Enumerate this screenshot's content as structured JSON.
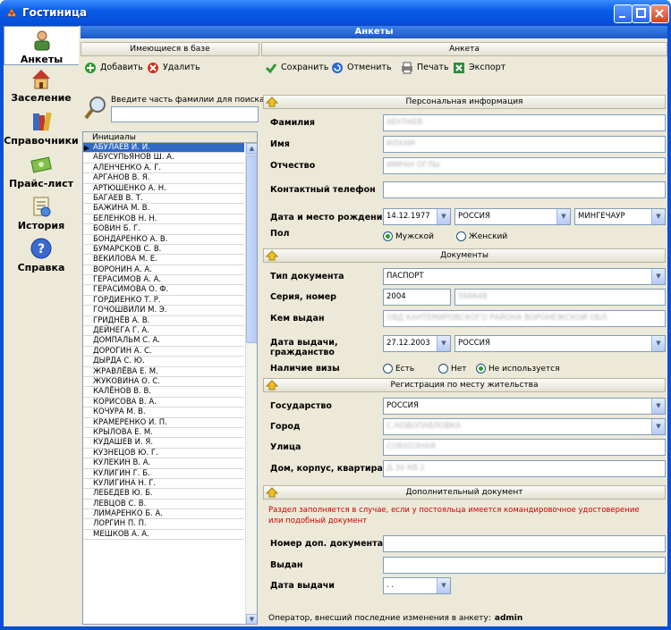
{
  "window": {
    "title": "Гостиница"
  },
  "nav": [
    {
      "label": "Анкеты",
      "icon": "person-icon"
    },
    {
      "label": "Заселение",
      "icon": "house-icon"
    },
    {
      "label": "Справочники",
      "icon": "books-icon"
    },
    {
      "label": "Прайс-лист",
      "icon": "money-icon"
    },
    {
      "label": "История",
      "icon": "clock-icon"
    },
    {
      "label": "Справка",
      "icon": "help-icon"
    }
  ],
  "top_strip": "Анкеты",
  "left": {
    "header": "Имеющиеся в базе",
    "add_label": "Добавить",
    "delete_label": "Удалить",
    "search_label": "Введите часть фамилии для поиска",
    "search_value": "",
    "column": "Инициалы",
    "rows": [
      "АБУЛАЕВ И. И.",
      "АБУСУПЬЯНОВ Ш. А.",
      "АЛЕНЧЕНКО А. Г.",
      "АРГАНОВ В. Я.",
      "АРТЮШЕНКО А. Н.",
      "БАГАЕВ В. Т.",
      "БАЖИНА М. В.",
      "БЕЛЕНКОВ Н. Н.",
      "БОВИН Б. Г.",
      "БОНДАРЕНКО А. В.",
      "БУМАРСКОВ С. В.",
      "ВЕКИЛОВА М. Е.",
      "ВОРОНИН А. А.",
      "ГЕРАСИМОВ А. А.",
      "ГЕРАСИМОВА О. Ф.",
      "ГОРДИЕНКО Т. Р.",
      "ГОЧОШВИЛИ М. Э.",
      "ГРИДНЁВ А. В.",
      "ДЕЙНЕГА Г. А.",
      "ДОМПАЛЬМ С. А.",
      "ДОРОГИН А. С.",
      "ДЫРДА С. Ю.",
      "ЖРАВЛЁВА Е. М.",
      "ЖУКОВИНА О. С.",
      "КАЛЁНОВ В. В.",
      "КОРИСОВА В. А.",
      "КОЧУРА М. В.",
      "КРАМЕРЕНКО И. П.",
      "КРЫЛОВА Е. М.",
      "КУДАШЕВ И. Я.",
      "КУЗНЕЦОВ Ю. Г.",
      "КУЛЕКИН В. А.",
      "КУЛИГИН Г. Б.",
      "КУЛИГИНА Н. Г.",
      "ЛЕБЕДЕВ Ю. Б.",
      "ЛЕВЦОВ С. В.",
      "ЛИМАРЕНКО Б. А.",
      "ЛОРГИН П. П.",
      "МЕШКОВ А. А."
    ]
  },
  "right": {
    "header": "Анкета",
    "save_label": "Сохранить",
    "cancel_label": "Отменить",
    "print_label": "Печать",
    "export_label": "Экспорт",
    "sec_personal": "Персональная информация",
    "surname_label": "Фамилия",
    "surname_value": "АБУЛАЕВ",
    "name_label": "Имя",
    "name_value": "ИЛХАМ",
    "patronymic_label": "Отчество",
    "patronymic_value": "ИМРАН ОГЛЫ",
    "phone_label": "Контактный телефон",
    "phone_value": "",
    "birth_label": "Дата и место рождения",
    "birth_date": "14.12.1977",
    "birth_country": "РОССИЯ",
    "birth_city": "МИНГЕЧАУР",
    "gender_label": "Пол",
    "gender_male": "Мужской",
    "gender_female": "Женский",
    "sec_docs": "Документы",
    "doctype_label": "Тип документа",
    "doctype_value": "ПАСПОРТ",
    "series_label": "Серия, номер",
    "series_value": "2004",
    "number_value": "566648",
    "issued_label": "Кем выдан",
    "issued_value": "ОВД КАНТЕМИРОВСКОГО РАЙОНА ВОРОНЕЖСКОЙ ОБЛ.",
    "issue_date_label": "Дата выдачи, гражданство",
    "issue_date": "27.12.2003",
    "citizenship": "РОССИЯ",
    "visa_label": "Наличие визы",
    "visa_yes": "Есть",
    "visa_no": "Нет",
    "visa_na": "Не используется",
    "sec_reg": "Регистрация по месту жительства",
    "state_label": "Государство",
    "state_value": "РОССИЯ",
    "city_label": "Город",
    "city_value": "С.НОВОПАВЛОВКА",
    "street_label": "Улица",
    "street_value": "СОВХОЗНАЯ",
    "house_label": "Дом, корпус, квартира",
    "house_value": "Д.30 КВ.2",
    "sec_extra": "Дополнительный документ",
    "extra_note": "Раздел заполняется в случае, если у постояльца имеется командировочное удостоверение или подобный документ",
    "extra_num_label": "Номер доп. документа",
    "extra_num_value": "",
    "extra_issued_label": "Выдан",
    "extra_issued_value": "",
    "extra_date_label": "Дата выдачи",
    "extra_date_value": " .  .",
    "status_text": "Оператор, внесший последние изменения в анкету:",
    "status_user": "admin"
  },
  "colors": {
    "title_bar": "#0a5ce6",
    "selection": "#316ac5",
    "note": "#cc0000",
    "radio_dot": "#21a121"
  }
}
